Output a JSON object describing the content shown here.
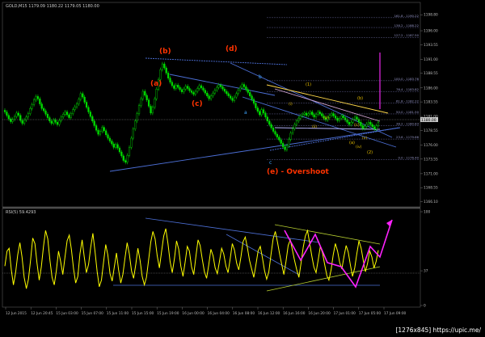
{
  "window": {
    "symbol_info": "GOLD,M15  1179.09 1180.22 1179.05 1180.00",
    "rsi_info": "RSI(5) 59.4293",
    "watermark": "[1276x845] https://upic.me/"
  },
  "colors": {
    "background": "#000000",
    "candle": "#00dd00",
    "rsi": "#ffff00",
    "trendline": "#4c6fd6",
    "label_red": "#ff3300",
    "label_blue": "#3fa6ff",
    "label_yellow": "#e8c000",
    "magenta": "#ff22ff",
    "fib": "#7f7fae"
  },
  "chart_data": [
    {
      "type": "candlestick",
      "title": "GOLD,M15",
      "ylim": [
        1166.6,
        1199.4
      ],
      "y_ticks": [
        "1198.80",
        "1196.00",
        "1193.55",
        "1191.00",
        "1188.55",
        "1186.00",
        "1183.55",
        "1181.00",
        "1178.55",
        "1176.00",
        "1173.55",
        "1171.00",
        "1168.55",
        "1166.10"
      ],
      "x_ticks": [
        "12 Jun 2015",
        "12 Jun 20:45",
        "15 Jun 03:00",
        "15 Jun 07:00",
        "15 Jun 11:00",
        "15 Jun 15:00",
        "15 Jun 19:00",
        "16 Jun 00:00",
        "16 Jun 04:00",
        "16 Jun 08:00",
        "16 Jun 12:00",
        "16 Jun 16:00",
        "16 Jun 20:00",
        "17 Jun 01:00",
        "17 Jun 05:00",
        "17 Jun 09:00"
      ],
      "price_marker": "1180.00",
      "close_series": [
        1181.8,
        1181.2,
        1180.6,
        1180.1,
        1180.5,
        1181.0,
        1181.6,
        1181.2,
        1180.3,
        1179.8,
        1180.4,
        1180.9,
        1181.5,
        1182.4,
        1183.1,
        1183.9,
        1184.5,
        1184.1,
        1183.2,
        1182.4,
        1182.0,
        1181.4,
        1180.8,
        1180.2,
        1179.8,
        1180.4,
        1180.0,
        1179.6,
        1180.3,
        1180.9,
        1181.4,
        1181.8,
        1181.3,
        1180.8,
        1181.5,
        1182.2,
        1182.7,
        1183.2,
        1184.0,
        1185.0,
        1184.4,
        1183.5,
        1182.6,
        1181.8,
        1181.0,
        1180.2,
        1179.4,
        1178.6,
        1177.9,
        1178.4,
        1179.1,
        1178.5,
        1177.8,
        1177.2,
        1176.7,
        1176.2,
        1175.6,
        1176.1,
        1175.5,
        1174.8,
        1174.1,
        1173.3,
        1173.0,
        1174.2,
        1175.6,
        1177.2,
        1178.8,
        1180.2,
        1181.5,
        1182.9,
        1184.1,
        1185.4,
        1184.7,
        1183.9,
        1182.8,
        1181.6,
        1182.6,
        1184.1,
        1185.8,
        1187.5,
        1189.2,
        1190.2,
        1189.5,
        1188.6,
        1187.7,
        1187.0,
        1186.4,
        1185.9,
        1186.5,
        1186.1,
        1185.7,
        1185.3,
        1185.8,
        1186.3,
        1185.9,
        1185.5,
        1185.2,
        1184.9,
        1185.4,
        1185.9,
        1186.4,
        1186.0,
        1185.6,
        1185.1,
        1184.6,
        1184.1,
        1184.6,
        1185.1,
        1185.6,
        1186.1,
        1186.5,
        1186.2,
        1185.8,
        1185.4,
        1185.0,
        1184.6,
        1184.2,
        1183.8,
        1184.4,
        1185.0,
        1185.6,
        1186.1,
        1186.6,
        1186.2,
        1185.7,
        1185.2,
        1184.6,
        1184.0,
        1183.3,
        1182.5,
        1181.9,
        1181.3,
        1182.2,
        1181.6,
        1180.9,
        1180.2,
        1179.6,
        1179.0,
        1178.4,
        1177.9,
        1177.4,
        1176.9,
        1176.3,
        1175.7,
        1175.2,
        1175.9,
        1177.0,
        1178.1,
        1178.9,
        1179.6,
        1180.2,
        1180.7,
        1181.1,
        1181.4,
        1181.6,
        1181.2,
        1181.5,
        1181.8,
        1181.3,
        1180.9,
        1181.4,
        1181.8,
        1181.5,
        1181.1,
        1180.7,
        1180.4,
        1180.8,
        1181.2,
        1181.5,
        1181.1,
        1180.7,
        1180.3,
        1180.7,
        1181.1,
        1180.8,
        1180.4,
        1180.0,
        1179.6,
        1180.0,
        1180.5,
        1180.9,
        1180.5,
        1180.0,
        1179.4,
        1178.9,
        1179.3,
        1179.7,
        1180.0,
        1179.6,
        1179.2,
        1178.8,
        1179.4,
        1180.0
      ],
      "fib_levels": [
        "161.8 - 1190.22",
        "138.2 - 1188.22",
        "127.2 - 1187.50",
        "100.0 - 1183.76",
        "76.4 - 1183.82",
        "61.8 - 1182.22",
        "50.0 - 1181.50",
        "38.2 - 1180.83",
        "23.6 - 1179.66",
        "0.0 - 1176.40"
      ],
      "annotations": [
        {
          "text": "(b)",
          "color": "red"
        },
        {
          "text": "(a)",
          "color": "red"
        },
        {
          "text": "(c)",
          "color": "red"
        },
        {
          "text": "(d)",
          "color": "red"
        },
        {
          "text": "(e) - Overshoot",
          "color": "red"
        },
        {
          "text": "b",
          "color": "blue"
        },
        {
          "text": "a",
          "color": "blue"
        },
        {
          "text": "c",
          "color": "blue"
        },
        {
          "text": "(1)",
          "color": "yellow"
        },
        {
          "text": "(2)",
          "color": "yellow"
        },
        {
          "text": "(b)",
          "color": "yellow"
        },
        {
          "text": "(c)",
          "color": "yellow"
        },
        {
          "text": "(a)",
          "color": "yellow"
        },
        {
          "text": "(v)",
          "color": "yellow"
        },
        {
          "text": "(iv)",
          "color": "yellow"
        },
        {
          "text": "(iii)",
          "color": "yellow"
        },
        {
          "text": "(ii)",
          "color": "yellow"
        },
        {
          "text": "(i)",
          "color": "yellow"
        }
      ]
    },
    {
      "type": "line",
      "title": "RSI(5) 59.4293",
      "ylim": [
        0,
        100
      ],
      "y_ticks": [
        "100",
        "37",
        "0"
      ],
      "values": [
        42,
        58,
        61,
        38,
        22,
        35,
        54,
        67,
        52,
        30,
        18,
        28,
        49,
        72,
        66,
        45,
        27,
        41,
        63,
        80,
        71,
        48,
        30,
        22,
        37,
        58,
        47,
        33,
        51,
        69,
        75,
        60,
        39,
        24,
        31,
        55,
        70,
        52,
        35,
        44,
        62,
        77,
        58,
        36,
        20,
        27,
        46,
        65,
        54,
        34,
        26,
        41,
        56,
        38,
        24,
        33,
        51,
        67,
        55,
        37,
        29,
        44,
        61,
        48,
        31,
        22,
        30,
        49,
        68,
        79,
        71,
        53,
        40,
        57,
        74,
        82,
        66,
        47,
        35,
        50,
        69,
        60,
        42,
        31,
        46,
        63,
        58,
        41,
        33,
        52,
        70,
        64,
        49,
        36,
        29,
        43,
        60,
        53,
        40,
        34,
        47,
        61,
        55,
        42,
        35,
        50,
        66,
        59,
        45,
        38,
        52,
        68,
        73,
        62,
        48,
        39,
        30,
        44,
        58,
        63,
        51,
        37,
        28,
        36,
        54,
        71,
        79,
        68,
        55,
        44,
        33,
        47,
        64,
        70,
        59,
        48,
        38,
        30,
        45,
        62,
        74,
        80,
        67,
        53,
        41,
        35,
        49,
        63,
        56,
        44,
        32,
        27,
        38,
        54,
        66,
        58,
        46,
        39,
        52,
        64,
        57,
        43,
        31,
        40,
        55,
        69,
        61,
        48,
        36,
        45,
        58,
        52,
        40,
        47,
        59
      ],
      "arrow_label": ""
    }
  ]
}
